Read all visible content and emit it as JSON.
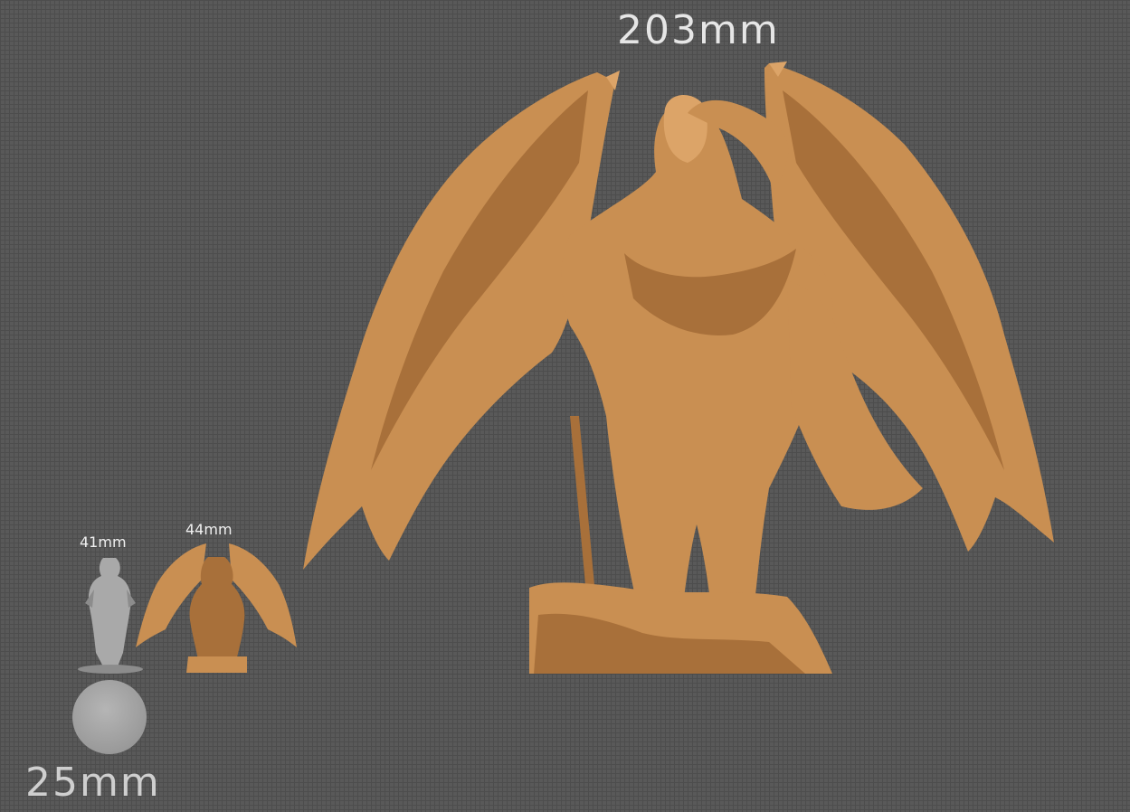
{
  "labels": {
    "large_figure": "203mm",
    "grey_figure": "41mm",
    "small_figure": "44mm",
    "base": "25mm"
  },
  "colors": {
    "background": "#595959",
    "grid": "#4d4d4d",
    "clay": "#c98f52",
    "grey_mini": "#a9a9a9",
    "label_text": "#e6e6e6"
  }
}
